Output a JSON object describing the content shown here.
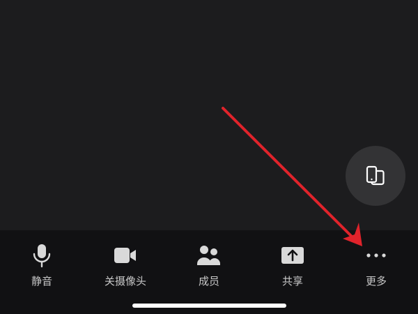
{
  "toolbar": {
    "items": [
      {
        "label": "静音",
        "icon": "microphone-icon"
      },
      {
        "label": "关摄像头",
        "icon": "video-camera-icon"
      },
      {
        "label": "成员",
        "icon": "members-icon"
      },
      {
        "label": "共享",
        "icon": "share-screen-icon"
      },
      {
        "label": "更多",
        "icon": "more-dots-icon"
      }
    ]
  },
  "floating_button": {
    "icon": "switch-device-icon"
  },
  "colors": {
    "background": "#1c1c1e",
    "toolbar_background": "#111113",
    "icon": "#d9d9d9",
    "label": "#c8c8c8",
    "annotation_arrow": "#e0232b"
  }
}
